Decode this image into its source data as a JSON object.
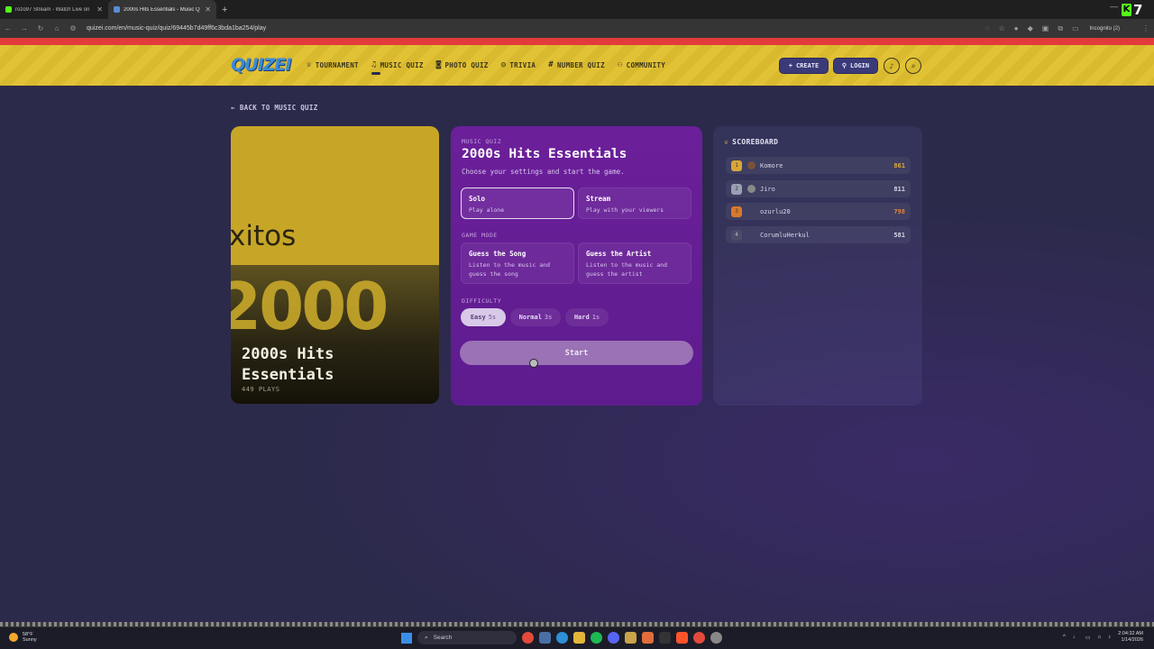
{
  "browser": {
    "tabs": [
      {
        "title": "rozo97 Stream - Watch Live on",
        "favicon_color": "#53fc18",
        "active": false
      },
      {
        "title": "2000s Hits Essentials - Music Q",
        "favicon_color": "#5a8dd6",
        "active": true
      }
    ],
    "url": "quizei.com/en/music-quiz/quiz/69445b7d49ff6c3bda1ba254/play",
    "incognito_label": "Incognito (2)",
    "extension_number": "7"
  },
  "header": {
    "logo": "QUIZEI",
    "nav": [
      {
        "label": "TOURNAMENT",
        "icon": "🏆",
        "active": false
      },
      {
        "label": "MUSIC QUIZ",
        "icon": "♫",
        "active": true
      },
      {
        "label": "PHOTO QUIZ",
        "icon": "◙",
        "active": false
      },
      {
        "label": "TRIVIA",
        "icon": "?",
        "active": false
      },
      {
        "label": "NUMBER QUIZ",
        "icon": "#",
        "active": false
      },
      {
        "label": "COMMUNITY",
        "icon": "⚇",
        "active": false
      }
    ],
    "create_label": "CREATE",
    "login_label": "LOGIN"
  },
  "back_label": "BACK TO MUSIC QUIZ",
  "cover": {
    "word": "xitos",
    "year": "2000",
    "title": "2000s Hits Essentials",
    "plays": "449 PLAYS"
  },
  "settings": {
    "kicker": "MUSIC QUIZ",
    "title": "2000s Hits Essentials",
    "subtitle": "Choose your settings and start the game.",
    "play_options": [
      {
        "title": "Solo",
        "desc": "Play alone",
        "selected": true
      },
      {
        "title": "Stream",
        "desc": "Play with your viewers",
        "selected": false
      }
    ],
    "game_mode_label": "GAME MODE",
    "modes": [
      {
        "title": "Guess the Song",
        "desc": "Listen to the music and guess the song"
      },
      {
        "title": "Guess the Artist",
        "desc": "Listen to the music and guess the artist"
      }
    ],
    "difficulty_label": "DIFFICULTY",
    "difficulties": [
      {
        "name": "Easy",
        "time": "5s",
        "selected": true
      },
      {
        "name": "Normal",
        "time": "3s",
        "selected": false
      },
      {
        "name": "Hard",
        "time": "1s",
        "selected": false
      }
    ],
    "start_label": "Start"
  },
  "scoreboard": {
    "title": "SCOREBOARD",
    "rows": [
      {
        "rank": "1",
        "name": "Komore",
        "points": "861",
        "rank_color": "#d9a63a",
        "points_color": "#e2a93a"
      },
      {
        "rank": "2",
        "name": "Jiro",
        "points": "811",
        "rank_color": "#9aa0b5",
        "points_color": "#d8d6ea"
      },
      {
        "rank": "3",
        "name": "ozurlu20",
        "points": "798",
        "rank_color": "#d9792d",
        "points_color": "#e0843a"
      },
      {
        "rank": "4",
        "name": "CorumluHerkul",
        "points": "581",
        "rank_color": "#4c4b6a",
        "points_color": "#d8d6ea"
      }
    ]
  },
  "taskbar": {
    "temp": "58°F",
    "weather": "Sunny",
    "search": "Search",
    "time": "2:04:32 AM",
    "date": "1/14/2026"
  }
}
